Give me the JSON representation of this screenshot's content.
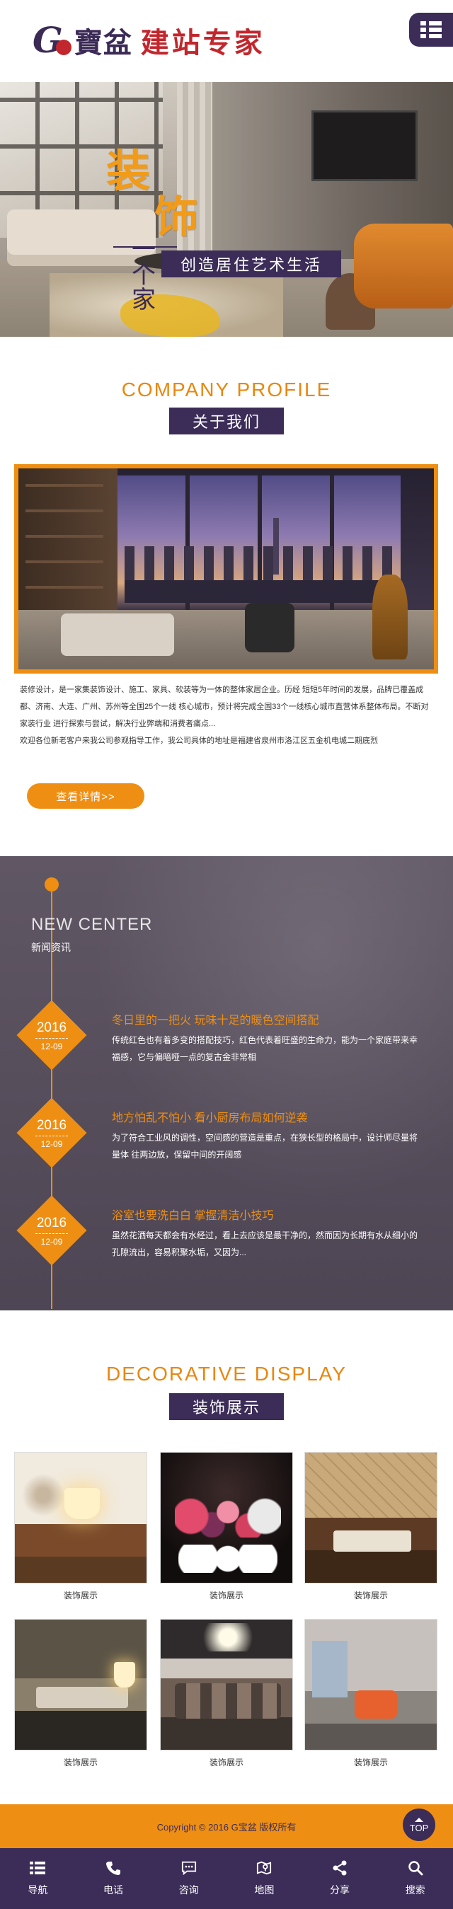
{
  "header": {
    "logo_mark": "G",
    "logo_cn": "寶盆",
    "logo_sub": "建站专家"
  },
  "banner": {
    "line1": "装",
    "line2": "饰",
    "line3": "一个家",
    "tagline": "创造居住艺术生活"
  },
  "about": {
    "title_en": "COMPANY PROFILE",
    "title_cn": "关于我们",
    "paragraphs": [
      "装修设计，是一家集装饰设计、施工、家具、软装等为一体的整体家居企业。历经 短短5年时间的发展，品牌已覆盖成都、济南、大连、广州、苏州等全国25个一线 核心城市，预计将完成全国33个一线核心城市直营体系整体布局。不断对家装行业 进行探索与尝试，解决行业弊端和消费者痛点...",
      "欢迎各位新老客户来我公司参观指导工作，我公司具体的地址是福建省泉州市洛江区五金机电城二期底烈"
    ],
    "more_label": "查看详情>>"
  },
  "news": {
    "title_en": "NEW CENTER",
    "title_cn": "新闻资讯",
    "items": [
      {
        "year": "2016",
        "date": "12-09",
        "title": "冬日里的一把火 玩味十足的暖色空间搭配",
        "desc": "传统红色也有着多变的搭配技巧，红色代表着旺盛的生命力，能为一个家庭带来幸福感，它与偏暗哑一点的复古金非常相"
      },
      {
        "year": "2016",
        "date": "12-09",
        "title": "地方怕乱不怕小 看小厨房布局如何逆袭",
        "desc": "为了符合工业风的调性，空间感的营造是重点，在狭长型的格局中，设计师尽量将量体 往两边放，保留中间的开阔感"
      },
      {
        "year": "2016",
        "date": "12-09",
        "title": "浴室也要洗白白 掌握清洁小技巧",
        "desc": "虽然花洒每天都会有水经过，看上去应该是最干净的，然而因为长期有水从细小的孔隙流出，容易积聚水垢，又因为..."
      }
    ]
  },
  "display": {
    "title_en": "DECORATIVE DISPLAY",
    "title_cn": "装饰展示",
    "items": [
      {
        "caption": "装饰展示"
      },
      {
        "caption": "装饰展示"
      },
      {
        "caption": "装饰展示"
      },
      {
        "caption": "装饰展示"
      },
      {
        "caption": "装饰展示"
      },
      {
        "caption": "装饰展示"
      }
    ]
  },
  "footer": {
    "copyright": "Copyright © 2016 G宝盆 版权所有",
    "top_label": "TOP"
  },
  "bottom_nav": [
    {
      "label": "导航",
      "icon": "menu-icon"
    },
    {
      "label": "电话",
      "icon": "phone-icon"
    },
    {
      "label": "咨询",
      "icon": "chat-icon"
    },
    {
      "label": "地图",
      "icon": "map-icon"
    },
    {
      "label": "分享",
      "icon": "share-icon"
    },
    {
      "label": "搜索",
      "icon": "search-icon"
    }
  ],
  "colors": {
    "primary_purple": "#3b2c58",
    "accent_orange": "#ee8f14",
    "news_bg": "#6e6571"
  }
}
